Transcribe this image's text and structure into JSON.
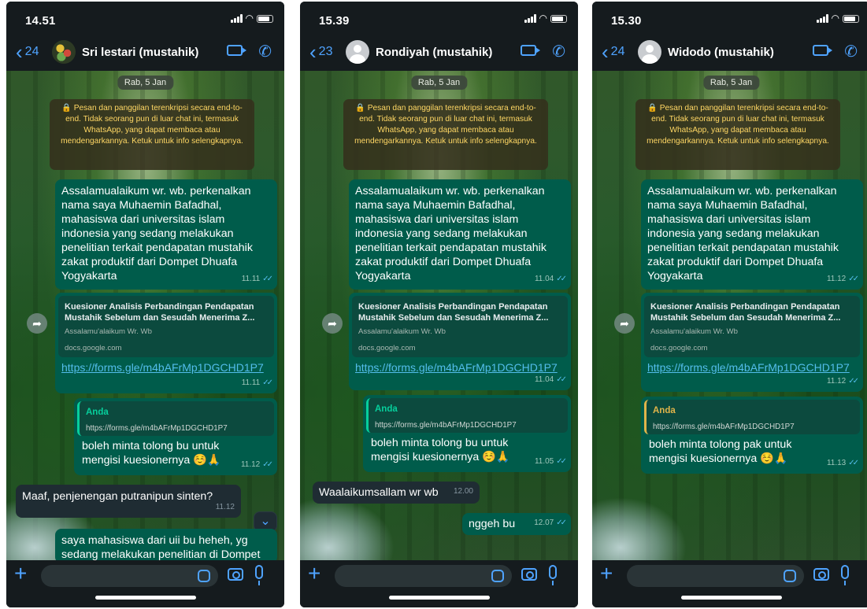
{
  "phones": [
    {
      "time": "14.51",
      "back_count": "24",
      "contact": "Sri lestari (mustahik)",
      "date": "Rab, 5 Jan",
      "encryption": "🔒 Pesan dan panggilan terenkripsi secara end-to-end. Tidak seorang pun di luar chat ini, termasuk WhatsApp, yang dapat membaca atau mendengarkannya. Ketuk untuk info selengkapnya.",
      "intro_text": "Assalamualaikum wr. wb. perkenalkan nama saya Muhaemin Bafadhal, mahasiswa dari universitas islam indonesia yang sedang melakukan penelitian terkait pendapatan mustahik zakat produktif dari Dompet Dhuafa Yogyakarta",
      "intro_time": "11.11",
      "link_title": "Kuesioner Analisis Perbandingan Pendapatan Mustahik Sebelum dan Sesudah Menerima Z...",
      "link_desc": "Assalamu'alaikum Wr. Wb",
      "link_domain": "docs.google.com",
      "link_url": "https://forms.gle/m4bAFrMp1DGCHD1P7",
      "link_time": "11.11",
      "quote_name": "Anda",
      "quote_text": "https://forms.gle/m4bAFrMp1DGCHD1P7",
      "reply_text": "boleh minta tolong bu untuk mengisi kuesionernya ☺️🙏",
      "reply_time": "11.12",
      "in1_text": "Maaf, penjenengan putranipun sinten?",
      "in1_time": "11.12",
      "out2_text": "saya mahasiswa dari uii bu heheh, yg sedang melakukan penelitian di Dompet"
    },
    {
      "time": "15.39",
      "back_count": "23",
      "contact": "Rondiyah (mustahik)",
      "date": "Rab, 5 Jan",
      "encryption": "🔒 Pesan dan panggilan terenkripsi secara end-to-end. Tidak seorang pun di luar chat ini, termasuk WhatsApp, yang dapat membaca atau mendengarkannya. Ketuk untuk info selengkapnya.",
      "intro_text": "Assalamualaikum wr. wb. perkenalkan nama saya Muhaemin Bafadhal, mahasiswa dari universitas islam indonesia yang sedang melakukan penelitian terkait pendapatan mustahik zakat produktif dari Dompet Dhuafa Yogyakarta",
      "intro_time": "11.04",
      "link_title": "Kuesioner Analisis Perbandingan Pendapatan Mustahik Sebelum dan Sesudah Menerima Z...",
      "link_desc": "Assalamu'alaikum Wr. Wb",
      "link_domain": "docs.google.com",
      "link_url": "https://forms.gle/m4bAFrMp1DGCHD1P7",
      "link_time": "11.04",
      "quote_name": "Anda",
      "quote_text": "https://forms.gle/m4bAFrMp1DGCHD1P7",
      "reply_text": "boleh minta tolong bu untuk mengisi kuesionernya ☺️🙏",
      "reply_time": "11.05",
      "in1_text": "Waalaikumsallam wr wb",
      "in1_time": "12.00",
      "out2_text": "nggeh bu",
      "out2_time": "12.07"
    },
    {
      "time": "15.30",
      "back_count": "24",
      "contact": "Widodo (mustahik)",
      "date": "Rab, 5 Jan",
      "encryption": "🔒 Pesan dan panggilan terenkripsi secara end-to-end. Tidak seorang pun di luar chat ini, termasuk WhatsApp, yang dapat membaca atau mendengarkannya. Ketuk untuk info selengkapnya.",
      "intro_text": "Assalamualaikum wr. wb. perkenalkan nama saya Muhaemin Bafadhal, mahasiswa dari universitas islam indonesia yang sedang melakukan penelitian terkait pendapatan mustahik zakat produktif dari Dompet Dhuafa Yogyakarta",
      "intro_time": "11.12",
      "link_title": "Kuesioner Analisis Perbandingan Pendapatan Mustahik Sebelum dan Sesudah Menerima Z...",
      "link_desc": "Assalamu'alaikum Wr. Wb",
      "link_domain": "docs.google.com",
      "link_url": "https://forms.gle/m4bAFrMp1DGCHD1P7",
      "link_time": "11.12",
      "quote_name": "Anda",
      "quote_text": "https://forms.gle/m4bAFrMp1DGCHD1P7",
      "reply_text": "boleh minta tolong pak untuk mengisi kuesionernya ☺️🙏",
      "reply_time": "11.13"
    }
  ],
  "colors": {
    "outgoing_bubble": "#005c4b",
    "incoming_bubble": "#1f2c33",
    "accent": "#4fa3ff",
    "read_ticks": "#53bdeb",
    "encryption_text": "#ffd764"
  }
}
